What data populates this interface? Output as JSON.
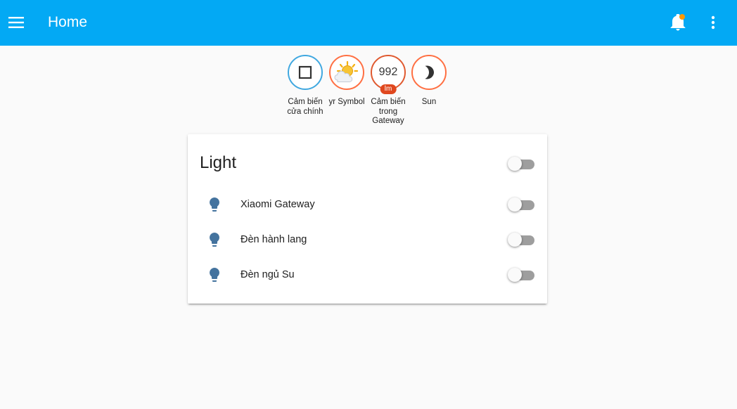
{
  "header": {
    "title": "Home",
    "icons": {
      "menu": "menu-icon",
      "notifications": "bell-icon",
      "more": "more-vertical-icon"
    },
    "colors": {
      "bar": "#03a9f4",
      "notification_dot": "#ff9800"
    }
  },
  "badges": [
    {
      "label": "Cảm biến cửa chính",
      "icon": "square-outline-icon"
    },
    {
      "label": "yr Symbol",
      "icon": "partly-cloudy-icon"
    },
    {
      "label": "Cảm biến trong Gateway",
      "value": "992",
      "unit": "lm"
    },
    {
      "label": "Sun",
      "icon": "moon-icon"
    }
  ],
  "card": {
    "title": "Light",
    "master_toggle_on": false,
    "entities": [
      {
        "name": "Xiaomi Gateway",
        "icon": "lightbulb-icon",
        "on": false
      },
      {
        "name": "Đèn hành lang",
        "icon": "lightbulb-icon",
        "on": false
      },
      {
        "name": "Đèn ngủ Su",
        "icon": "lightbulb-icon",
        "on": false
      }
    ],
    "icon_color": "#44739e"
  }
}
